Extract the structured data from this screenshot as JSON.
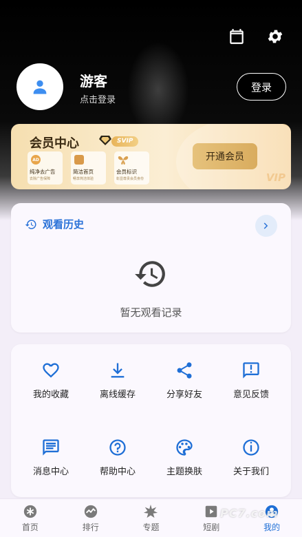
{
  "header": {
    "calendar_icon": "calendar-icon",
    "settings_icon": "gear-icon"
  },
  "user": {
    "name": "游客",
    "subtitle": "点击登录",
    "login_label": "登录"
  },
  "vip": {
    "title": "会员中心",
    "badge": "SVIP",
    "watermark": "VIP",
    "open_label": "开通会员",
    "benefits": [
      {
        "icon_text": "AD",
        "title": "纯净去广告",
        "subtitle": "去除广告保障"
      },
      {
        "icon_text": "",
        "title": "简洁首页",
        "subtitle": "畅享简洁体验"
      },
      {
        "icon_text": "",
        "title": "会员标识",
        "subtitle": "彰显尊贵会员身份"
      }
    ]
  },
  "history": {
    "title": "观看历史",
    "empty_text": "暂无观看记录"
  },
  "features": [
    {
      "label": "我的收藏",
      "icon": "heart-icon"
    },
    {
      "label": "离线缓存",
      "icon": "download-icon"
    },
    {
      "label": "分享好友",
      "icon": "share-icon"
    },
    {
      "label": "意见反馈",
      "icon": "feedback-icon"
    },
    {
      "label": "消息中心",
      "icon": "message-icon"
    },
    {
      "label": "帮助中心",
      "icon": "help-icon"
    },
    {
      "label": "主题换肤",
      "icon": "palette-icon"
    },
    {
      "label": "关于我们",
      "icon": "info-icon"
    }
  ],
  "nav": [
    {
      "label": "首页",
      "active": false
    },
    {
      "label": "排行",
      "active": false
    },
    {
      "label": "专题",
      "active": false
    },
    {
      "label": "短剧",
      "active": false
    },
    {
      "label": "我的",
      "active": true
    }
  ],
  "watermark_text": "PC7.com",
  "colors": {
    "accent": "#1f6fd6",
    "vip_gold": "#e6c27c"
  }
}
